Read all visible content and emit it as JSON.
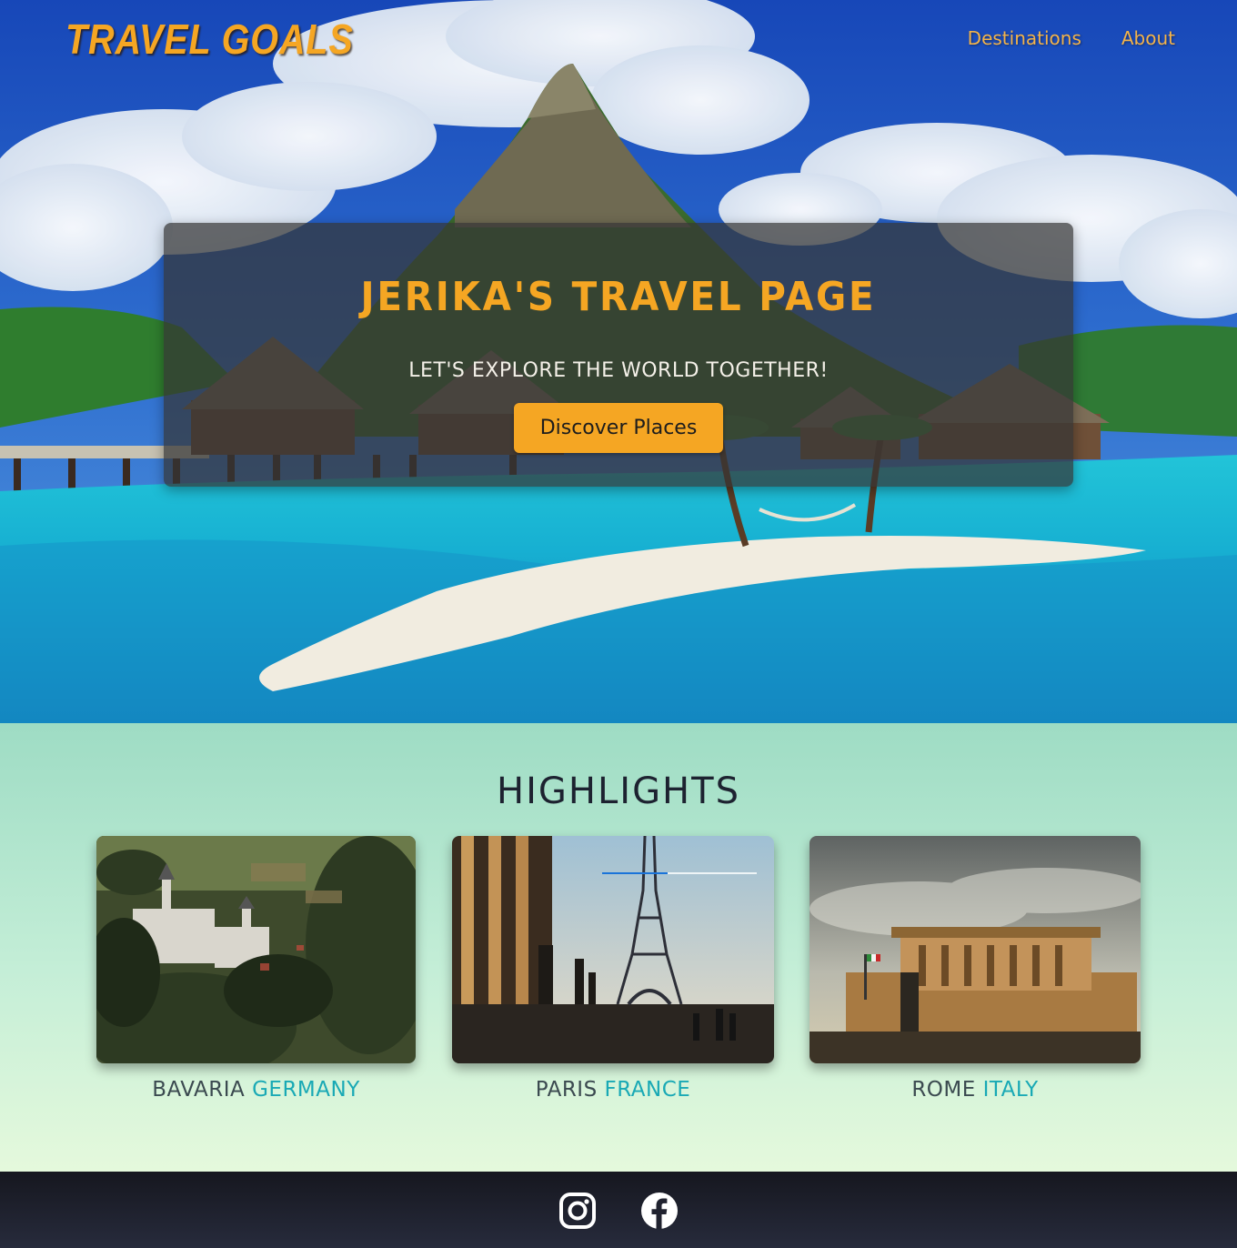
{
  "header": {
    "logo": "TRAVEL GOALS",
    "nav": [
      {
        "label": "Destinations"
      },
      {
        "label": "About"
      }
    ]
  },
  "hero": {
    "title": "JERIKA'S TRAVEL PAGE",
    "subtitle": "LET'S EXPLORE THE WORLD TOGETHER!",
    "button_label": "Discover Places"
  },
  "highlights": {
    "heading": "HIGHLIGHTS",
    "cards": [
      {
        "city": "BAVARIA",
        "country": "GERMANY"
      },
      {
        "city": "PARIS",
        "country": "FRANCE"
      },
      {
        "city": "ROME",
        "country": "ITALY"
      }
    ]
  },
  "footer": {
    "icons": [
      "instagram-icon",
      "facebook-icon"
    ]
  },
  "colors": {
    "accent": "#f5a623",
    "teal": "#19a9b5",
    "footer_bg": "#1c1d29",
    "highlights_bg_top": "#9edcc4",
    "highlights_bg_bottom": "#e5f9dc"
  }
}
